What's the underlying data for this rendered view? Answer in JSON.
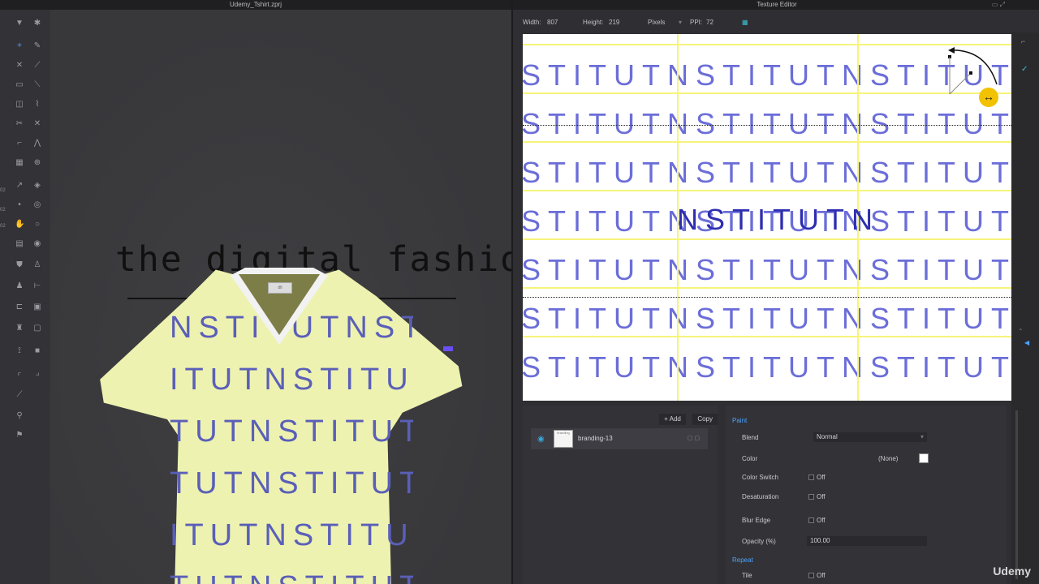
{
  "left_window": {
    "title": "Udemy_Tshirt.zprj"
  },
  "viewport": {
    "brand_text": "the digital fashion",
    "shirt_pattern_rows": [
      "NSTITUTNSTIT",
      "ITUTNSTITUTN",
      "TUTNSTITUTNS",
      "TUTNSTITUTN",
      "ITUTNSTITUTN",
      "TUTNSTITUTNS"
    ],
    "collar_label": "dfi"
  },
  "right_window": {
    "title": "Texture Editor"
  },
  "texture_dims": {
    "width_label": "Width:",
    "width_value": "807",
    "height_label": "Height:",
    "height_value": "219",
    "unit": "Pixels",
    "ppi_label": "PPI:",
    "ppi_value": "72"
  },
  "texture": {
    "row_text": "STITUTNSTITUTNSTITUT",
    "selected_text": "NSTITUTN"
  },
  "layers": {
    "add_label": "+ Add",
    "copy_label": "Copy",
    "item_name": "branding-13",
    "item_thumb": "branding"
  },
  "properties": {
    "paint_title": "Paint",
    "blend_label": "Blend",
    "blend_value": "Normal",
    "color_label": "Color",
    "color_value": "(None)",
    "color_switch_label": "Color Switch",
    "color_switch_value": "Off",
    "desaturation_label": "Desaturation",
    "desaturation_value": "Off",
    "blur_edge_label": "Blur Edge",
    "blur_edge_value": "Off",
    "opacity_label": "Opacity (%)",
    "opacity_value": "100.00",
    "repeat_title": "Repeat",
    "tile_label": "Tile",
    "tile_value": "Off"
  },
  "watermark": "Udemy",
  "colors": {
    "accent": "#4ca3ff",
    "shirt": "#eef2b0",
    "pattern": "#6b6ed8",
    "guide": "#f6f47a"
  }
}
